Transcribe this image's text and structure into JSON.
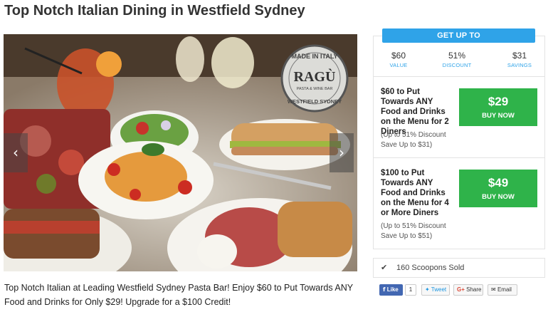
{
  "page": {
    "title": "Top Notch Italian Dining in Westfield Sydney",
    "description": "Top Notch Italian at Leading Westfield Sydney Pasta Bar! Enjoy $60 to Put Towards ANY Food and Drinks for Only $29! Upgrade for a $100 Credit!"
  },
  "photo": {
    "badge_top": "MADE IN ITALY",
    "badge_brand": "RAGÙ",
    "badge_sub": "PASTA & WINE BAR",
    "badge_bottom": "WESTFIELD SYDNEY",
    "prev_arrow": "‹",
    "next_arrow": "›"
  },
  "offer": {
    "banner": "GET UP TO",
    "stats": [
      {
        "value": "$60",
        "label": "VALUE"
      },
      {
        "value": "51%",
        "label": "DISCOUNT"
      },
      {
        "value": "$31",
        "label": "SAVINGS"
      }
    ]
  },
  "deals": [
    {
      "title": "$60 to Put Towards ANY Food and Drinks on the Menu for 2 Diners",
      "note_discount": "(Up to 51% Discount",
      "note_save": "Save Up to $31)",
      "price": "$29",
      "button": "BUY NOW"
    },
    {
      "title": "$100 to Put Towards ANY Food and Drinks on the Menu for 4 or More Diners",
      "note_discount": "(Up to 51% Discount",
      "note_save": "Save Up to $51)",
      "price": "$49",
      "button": "BUY NOW"
    }
  ],
  "sold": {
    "check": "✔",
    "text": "160 Scoopons Sold"
  },
  "share": {
    "like": "Like",
    "like_count": "1",
    "tweet": "Tweet",
    "gshare_g": "G+",
    "gshare": "Share",
    "email": "Email"
  },
  "colors": {
    "accent_blue": "#2fa3e8",
    "buy_green": "#2fb34a",
    "facebook": "#4267b2"
  }
}
